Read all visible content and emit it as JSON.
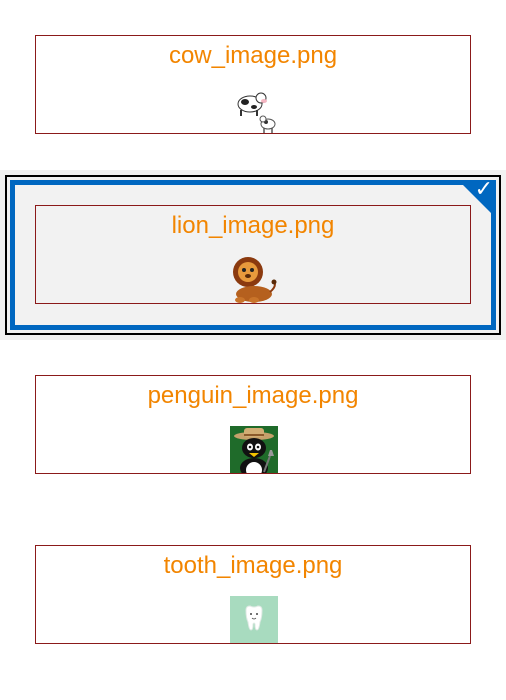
{
  "items": [
    {
      "filename": "cow_image.png",
      "thumbnail": "cow-icon",
      "selected": false
    },
    {
      "filename": "lion_image.png",
      "thumbnail": "lion-icon",
      "selected": true
    },
    {
      "filename": "penguin_image.png",
      "thumbnail": "penguin-icon",
      "selected": false
    },
    {
      "filename": "tooth_image.png",
      "thumbnail": "tooth-icon",
      "selected": false
    }
  ],
  "colors": {
    "title": "#f28500",
    "card_border": "#8b1a1a",
    "selection_accent": "#0067c0",
    "selection_background": "#f2f2f2"
  }
}
